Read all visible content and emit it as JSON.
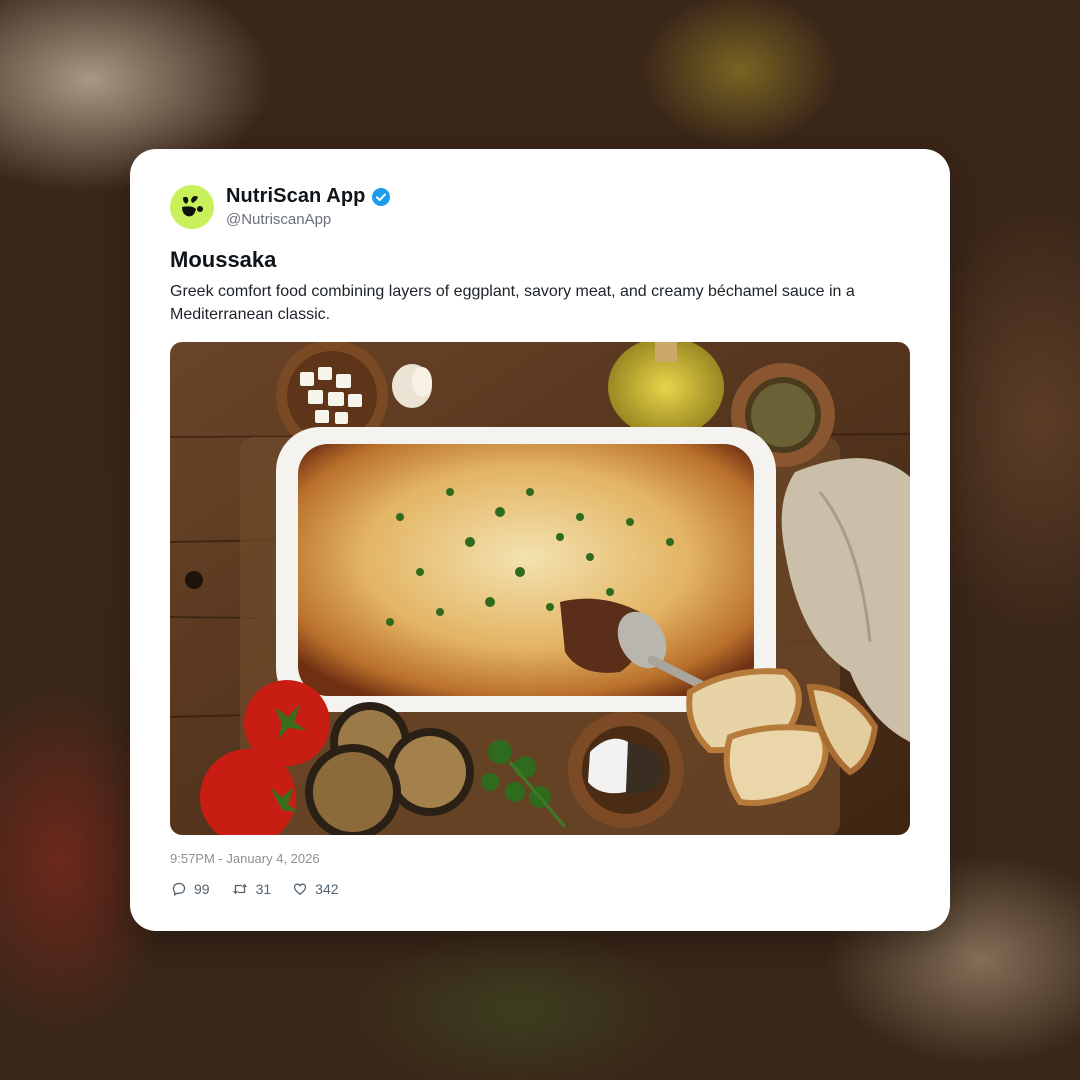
{
  "post": {
    "author_name": "NutriScan App",
    "author_handle": "@NutriscanApp",
    "verified": true,
    "title": "Moussaka",
    "description": "Greek comfort food combining layers of eggplant, savory meat, and creamy béchamel sauce in a Mediterranean classic.",
    "timestamp": "9:57PM - January 4, 2026",
    "image_icon": "moussaka-dish-photo",
    "stats": {
      "replies": "99",
      "retweets": "31",
      "likes": "342"
    }
  },
  "colors": {
    "avatar_bg": "#c8f05a",
    "verified_blue": "#1d9bf0",
    "card_bg": "#ffffff"
  },
  "icons": {
    "reply": "reply-icon",
    "retweet": "retweet-icon",
    "like": "heart-icon",
    "verified": "verified-badge-icon",
    "avatar": "leaf-logo-icon"
  }
}
